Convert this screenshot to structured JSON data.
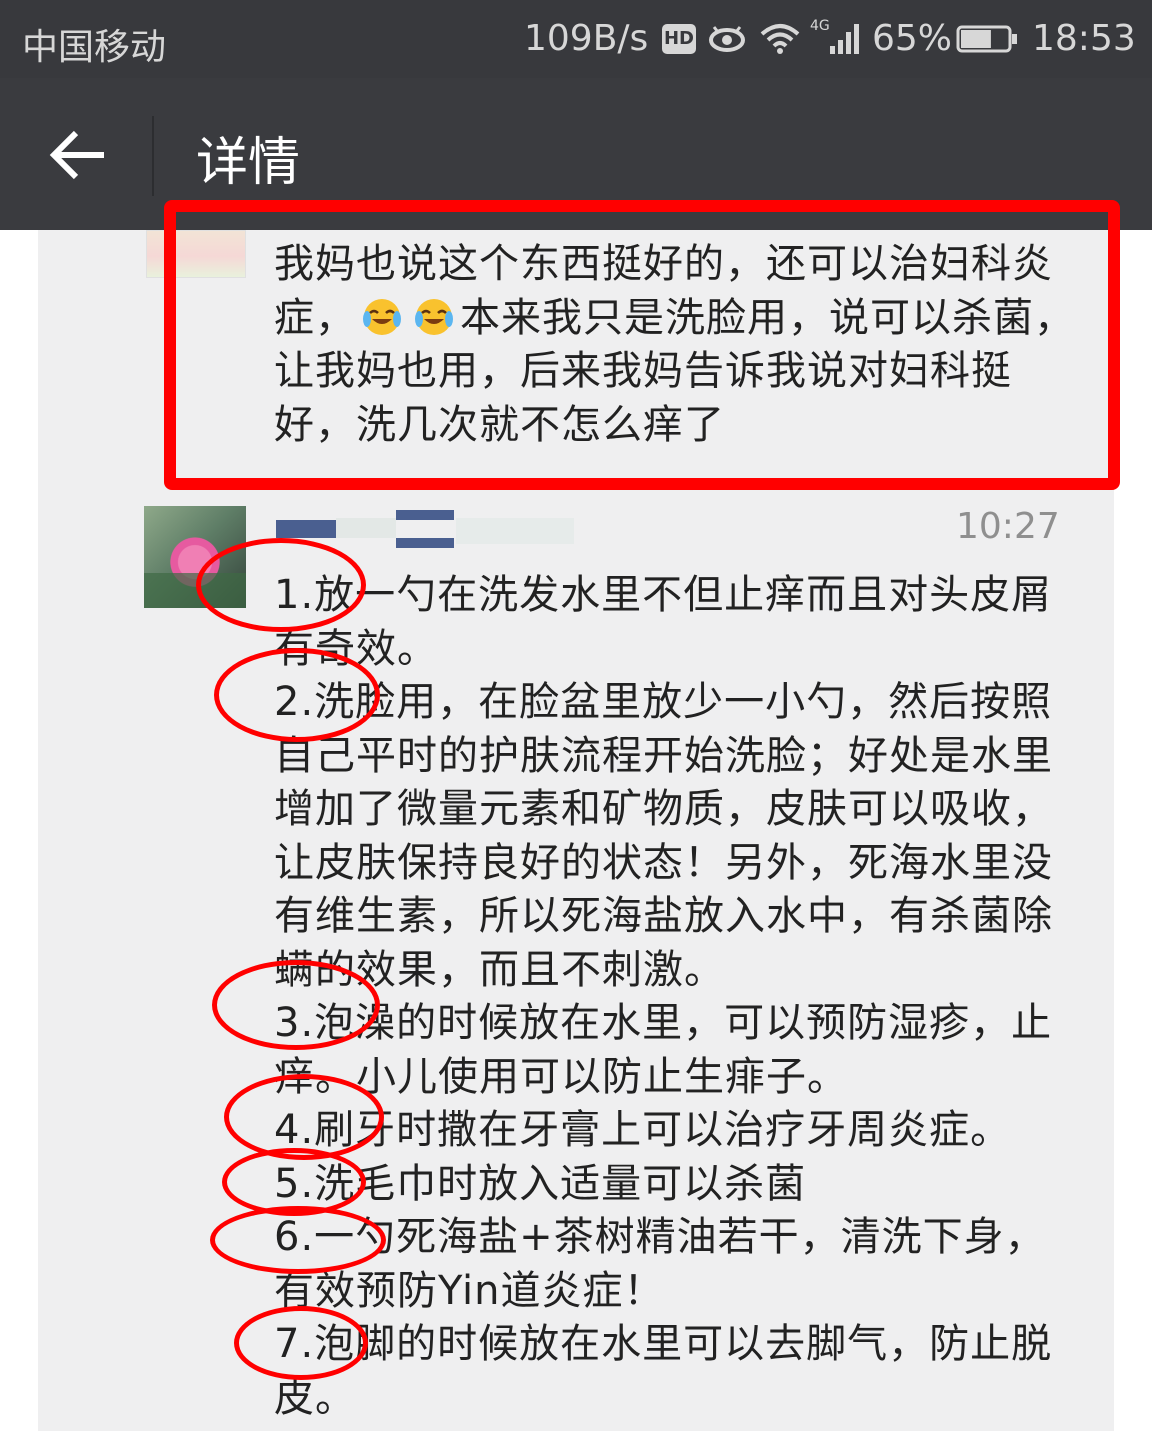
{
  "status_bar": {
    "carrier": "中国移动",
    "net_speed": "109B/s",
    "hd_badge": "HD",
    "network_type": "4G",
    "battery_percent": "65%",
    "battery_level": 0.65,
    "time": "18:53"
  },
  "header": {
    "title": "详情",
    "back_icon": "arrow-left-icon"
  },
  "messages": [
    {
      "text_before_emoji": "我妈也说这个东西挺好的，还可以治妇科炎症，",
      "emoji": "crying-laughing-emoji",
      "text_after_emoji": "本来我只是洗脸用，说可以杀菌，让我妈也用，后来我妈告诉我说对妇科挺好，洗几次就不怎么痒了"
    },
    {
      "time": "10:27",
      "text": "1.放一勺在洗发水里不但止痒而且对头皮屑有奇效。\n2.洗脸用，在脸盆里放少一小勺，然后按照自己平时的护肤流程开始洗脸；好处是水里增加了微量元素和矿物质，皮肤可以吸收，让皮肤保持良好的状态！另外，死海水里没有维生素，所以死海盐放入水中，有杀菌除螨的效果，而且不刺激。\n3.泡澡的时候放在水里，可以预防湿疹，止痒。小儿使用可以防止生痱子。\n4.刷牙时撒在牙膏上可以治疗牙周炎症。\n5.洗毛巾时放入适量可以杀菌\n6.一勺死海盐+茶树精油若干，清洗下身，有效预防Yin道炎症！\n7.泡脚的时候放在水里可以去脚气，防止脱皮。"
    }
  ],
  "annotation_color": "#ff0000"
}
